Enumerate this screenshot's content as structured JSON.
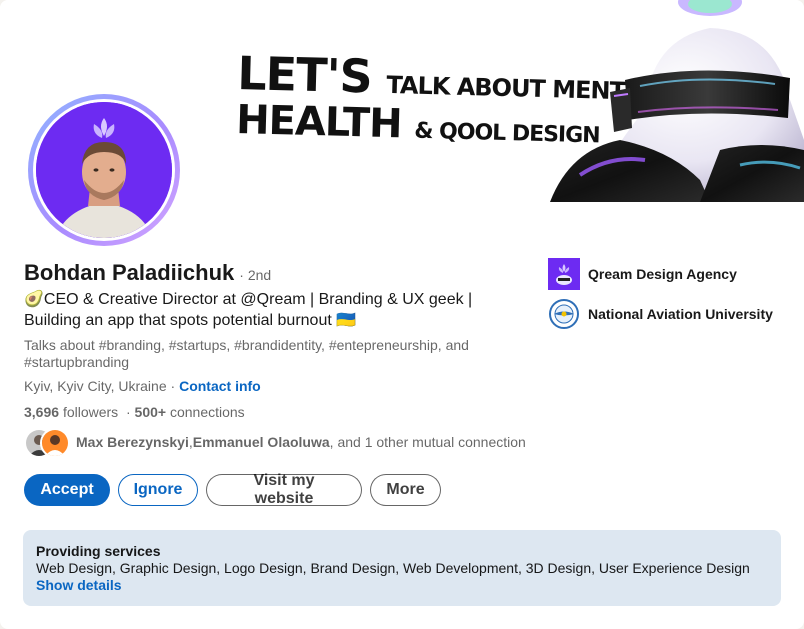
{
  "banner": {
    "line1_big": "LET'S",
    "line1_small": "TALK ABOUT MENTAL",
    "line2_big": "HEALTH",
    "line2_small": "& QOOL DESIGN"
  },
  "profile": {
    "name": "Bohdan Paladiichuk",
    "degree": "· 2nd",
    "headline": "🥑CEO & Creative Director at @Qream | Branding & UX geek | Building an app that spots potential burnout 🇺🇦",
    "talks": "Talks about #branding, #startups, #brandidentity, #entepreneurship, and #startupbranding",
    "location": "Kyiv, Kyiv City, Ukraine",
    "location_sep": " · ",
    "contact_label": "Contact info",
    "followers_count": "3,696",
    "followers_label": "followers",
    "connections_prefix": "·",
    "connections_count": "500+",
    "connections_label": "connections"
  },
  "mutual": {
    "name1": "Max Berezynskyi",
    "sep": ", ",
    "name2": "Emmanuel Olaoluwa",
    "rest": ", and 1 other mutual connection"
  },
  "buttons": {
    "accept": "Accept",
    "ignore": "Ignore",
    "website": "Visit my website",
    "more": "More"
  },
  "services": {
    "title": "Providing services",
    "list": "Web Design, Graphic Design, Logo Design, Brand Design, Web Development, 3D Design, User Experience Design",
    "link": "Show details"
  },
  "experience": {
    "company": "Qream Design Agency",
    "education": "National Aviation University"
  },
  "colors": {
    "primary": "#0a66c2",
    "avatar_bg": "#6d2bf2",
    "services_bg": "#dde7f1"
  }
}
